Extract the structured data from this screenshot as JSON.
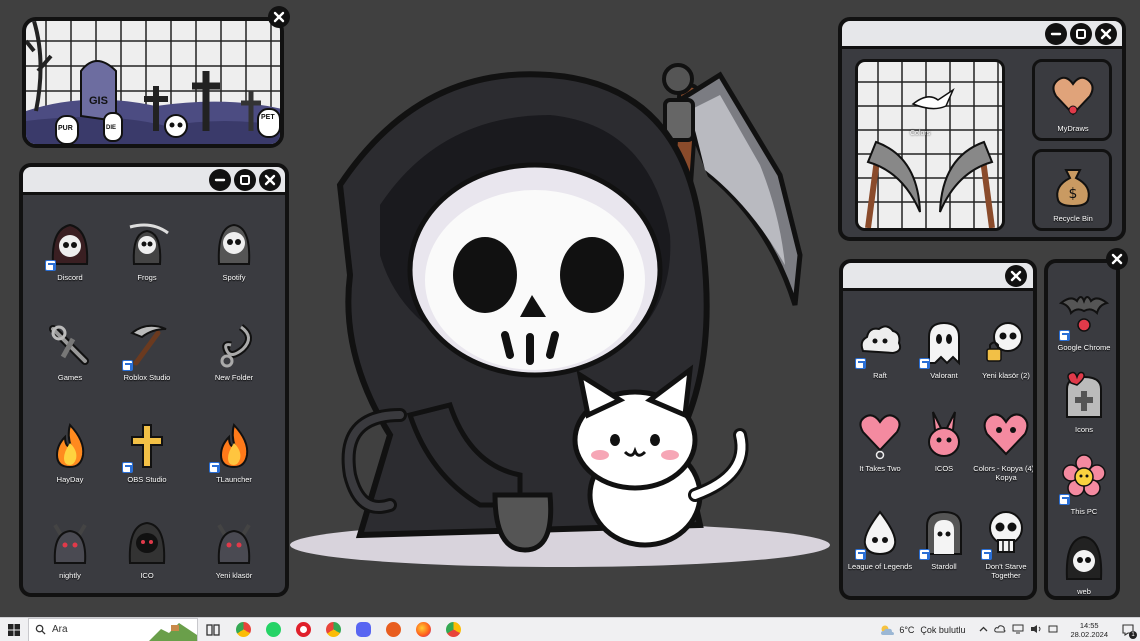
{
  "desktop": {
    "window_apps": {
      "icons": [
        {
          "label": "Discord",
          "shortcut": true
        },
        {
          "label": "Frogs",
          "shortcut": false
        },
        {
          "label": "Spotify",
          "shortcut": false
        },
        {
          "label": "Games",
          "shortcut": false
        },
        {
          "label": "Roblox Studio",
          "shortcut": true
        },
        {
          "label": "New Folder",
          "shortcut": false
        },
        {
          "label": "HayDay",
          "shortcut": false
        },
        {
          "label": "OBS Studio",
          "shortcut": true
        },
        {
          "label": "TLauncher",
          "shortcut": true
        },
        {
          "label": "nightly",
          "shortcut": false
        },
        {
          "label": "ICO",
          "shortcut": false
        },
        {
          "label": "Yeni klasör",
          "shortcut": false
        }
      ]
    },
    "window_top_right": {
      "icons": [
        {
          "label": "Colors",
          "shortcut": false
        },
        {
          "label": "MyDraws",
          "shortcut": false
        },
        {
          "label": "Recycle Bin",
          "shortcut": false
        }
      ]
    },
    "window_bottom_right": {
      "icons": [
        {
          "label": "Raft",
          "shortcut": true
        },
        {
          "label": "Valorant",
          "shortcut": true
        },
        {
          "label": "Yeni klasör (2)",
          "shortcut": false
        },
        {
          "label": "It Takes Two",
          "shortcut": false
        },
        {
          "label": "ICOS",
          "shortcut": false
        },
        {
          "label": "Colors - Kopya (4) - Kopya",
          "shortcut": false
        },
        {
          "label": "League of Legends",
          "shortcut": true
        },
        {
          "label": "Stardoll",
          "shortcut": true
        },
        {
          "label": "Don't Starve Together",
          "shortcut": true
        }
      ]
    },
    "window_far_right": {
      "icons": [
        {
          "label": "Google Chrome",
          "shortcut": true
        },
        {
          "label": "Icons",
          "shortcut": false
        },
        {
          "label": "This PC",
          "shortcut": true
        },
        {
          "label": "web",
          "shortcut": false
        }
      ]
    },
    "graveyard": {
      "tombstones": [
        "GIS",
        "PUR",
        "DIE",
        "PET"
      ]
    }
  },
  "taskbar": {
    "search_placeholder": "Ara",
    "apps": [
      {
        "name": "task-view",
        "color": "#444444"
      },
      {
        "name": "chrome",
        "color": "#e8443a"
      },
      {
        "name": "whatsapp",
        "color": "#25d366"
      },
      {
        "name": "opera",
        "color": "#e0202b"
      },
      {
        "name": "chrome-2",
        "color": "#34a853"
      },
      {
        "name": "discord",
        "color": "#5865f2"
      },
      {
        "name": "brave",
        "color": "#e85d1f"
      },
      {
        "name": "firefox",
        "color": "#ff7a1a"
      },
      {
        "name": "chrome-3",
        "color": "#fbbc05"
      }
    ],
    "weather": {
      "temp": "6°C",
      "condition": "Çok bulutlu"
    },
    "clock": {
      "time": "14:55",
      "date": "28.02.2024"
    },
    "notifications": "1"
  },
  "colors": {
    "window_bg": "#3a3b40",
    "titlebar": "#e6e7ea",
    "desktop_bg": "#404040"
  }
}
